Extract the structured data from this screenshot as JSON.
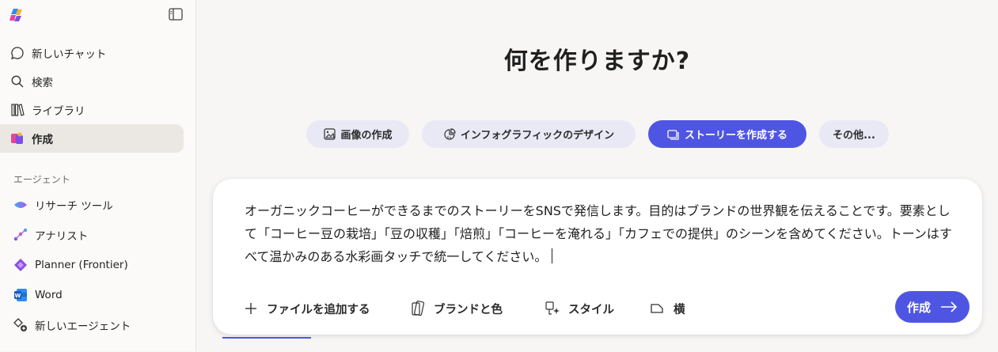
{
  "sidebar": {
    "nav": [
      {
        "label": "新しいチャット",
        "icon": "chat-bubble-icon"
      },
      {
        "label": "検索",
        "icon": "search-icon"
      },
      {
        "label": "ライブラリ",
        "icon": "library-icon"
      },
      {
        "label": "作成",
        "icon": "create-icon",
        "active": true
      }
    ],
    "agents_section_label": "エージェント",
    "agents": [
      {
        "label": "リサーチ ツール",
        "icon": "researcher-icon"
      },
      {
        "label": "アナリスト",
        "icon": "analyst-icon"
      },
      {
        "label": "Planner (Frontier)",
        "icon": "planner-icon"
      },
      {
        "label": "Word",
        "icon": "word-icon"
      },
      {
        "label": "新しいエージェント",
        "icon": "new-agent-icon"
      }
    ]
  },
  "main": {
    "heading": "何を作りますか?",
    "chips": [
      {
        "label": "画像の作成",
        "icon": "image-icon"
      },
      {
        "label": "インフォグラフィックのデザイン",
        "icon": "infographic-icon"
      },
      {
        "label": "ストーリーを作成する",
        "icon": "story-icon",
        "selected": true
      },
      {
        "label": "その他...",
        "icon": ""
      }
    ],
    "composer": {
      "text": "オーガニックコーヒーができるまでのストーリーをSNSで発信します。目的はブランドの世界観を伝えることです。要素として「コーヒー豆の栽培」「豆の収穫」「焙煎」「コーヒーを淹れる」「カフェでの提供」のシーンを含めてください。トーンはすべて温かみのある水彩画タッチで統一してください。",
      "tools": [
        {
          "label": "ファイルを追加する",
          "icon": "plus-icon"
        },
        {
          "label": "ブランドと色",
          "icon": "brand-icon"
        },
        {
          "label": "スタイル",
          "icon": "style-icon"
        },
        {
          "label": "横",
          "icon": "landscape-icon"
        }
      ],
      "submit_label": "作成"
    }
  },
  "colors": {
    "accent": "#4f55e3",
    "chip_bg": "#e9e9f6",
    "active_nav_bg": "#ebe8e4"
  }
}
